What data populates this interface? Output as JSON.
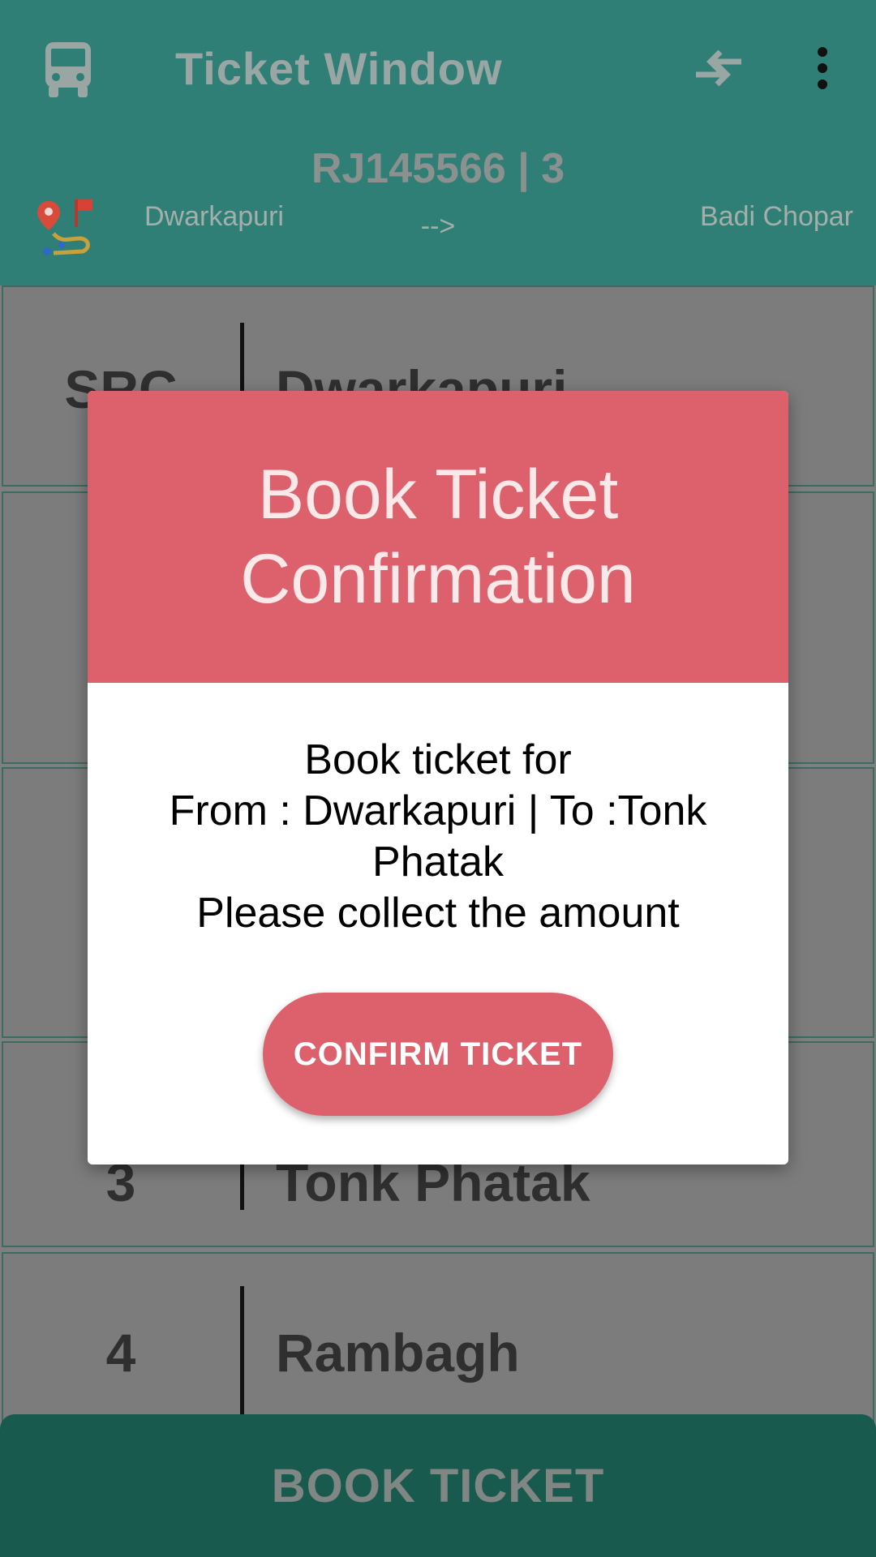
{
  "app_bar": {
    "title": "Ticket Window",
    "bus_id": "RJ145566 | 3",
    "from_stop": "Dwarkapuri",
    "arrow": "-->",
    "to_stop": "Badi Chopar"
  },
  "stops": [
    {
      "number": "SRC",
      "name": "Dwarkapuri"
    },
    {
      "number": "",
      "name": ""
    },
    {
      "number": "",
      "name": ""
    },
    {
      "number": "3",
      "name": "Tonk Phatak"
    },
    {
      "number": "4",
      "name": "Rambagh"
    }
  ],
  "bottom_button": {
    "label": "BOOK TICKET"
  },
  "dialog": {
    "title": "Book Ticket Confirmation",
    "message": "Book ticket for\nFrom : Dwarkapuri | To :Tonk Phatak\nPlease collect the amount",
    "confirm_label": "CONFIRM TICKET"
  },
  "colors": {
    "primary": "#2f7f76",
    "dialog_accent": "#dc616c",
    "book_button": "#195a4f"
  },
  "icons": {
    "leading": "bus-icon",
    "swap": "swap-arrows-icon",
    "more": "more-vertical-icon",
    "route": "route-map-icon"
  }
}
